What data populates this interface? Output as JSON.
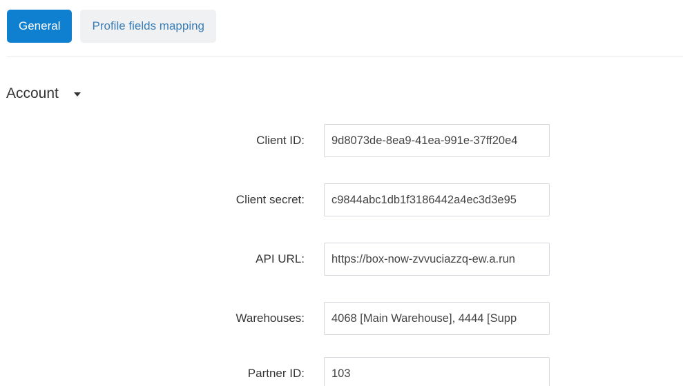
{
  "tabs": [
    {
      "label": "General",
      "active": true
    },
    {
      "label": "Profile fields mapping",
      "active": false
    }
  ],
  "section": {
    "title": "Account"
  },
  "fields": [
    {
      "label": "Client ID:",
      "value": "9d8073de-8ea9-41ea-991e-37ff20e4"
    },
    {
      "label": "Client secret:",
      "value": "c9844abc1db1f3186442a4ec3d3e95"
    },
    {
      "label": "API URL:",
      "value": "https://box-now-zvvuciazzq-ew.a.run"
    },
    {
      "label": "Warehouses:",
      "value": "4068 [Main Warehouse], 4444 [Supp"
    },
    {
      "label": "Partner ID:",
      "value": "103"
    }
  ],
  "colors": {
    "accent": "#0f7fd0",
    "tab_inactive_bg": "#f0f1f2",
    "tab_inactive_text": "#3a7fb8",
    "input_border": "#d5d9dd"
  }
}
